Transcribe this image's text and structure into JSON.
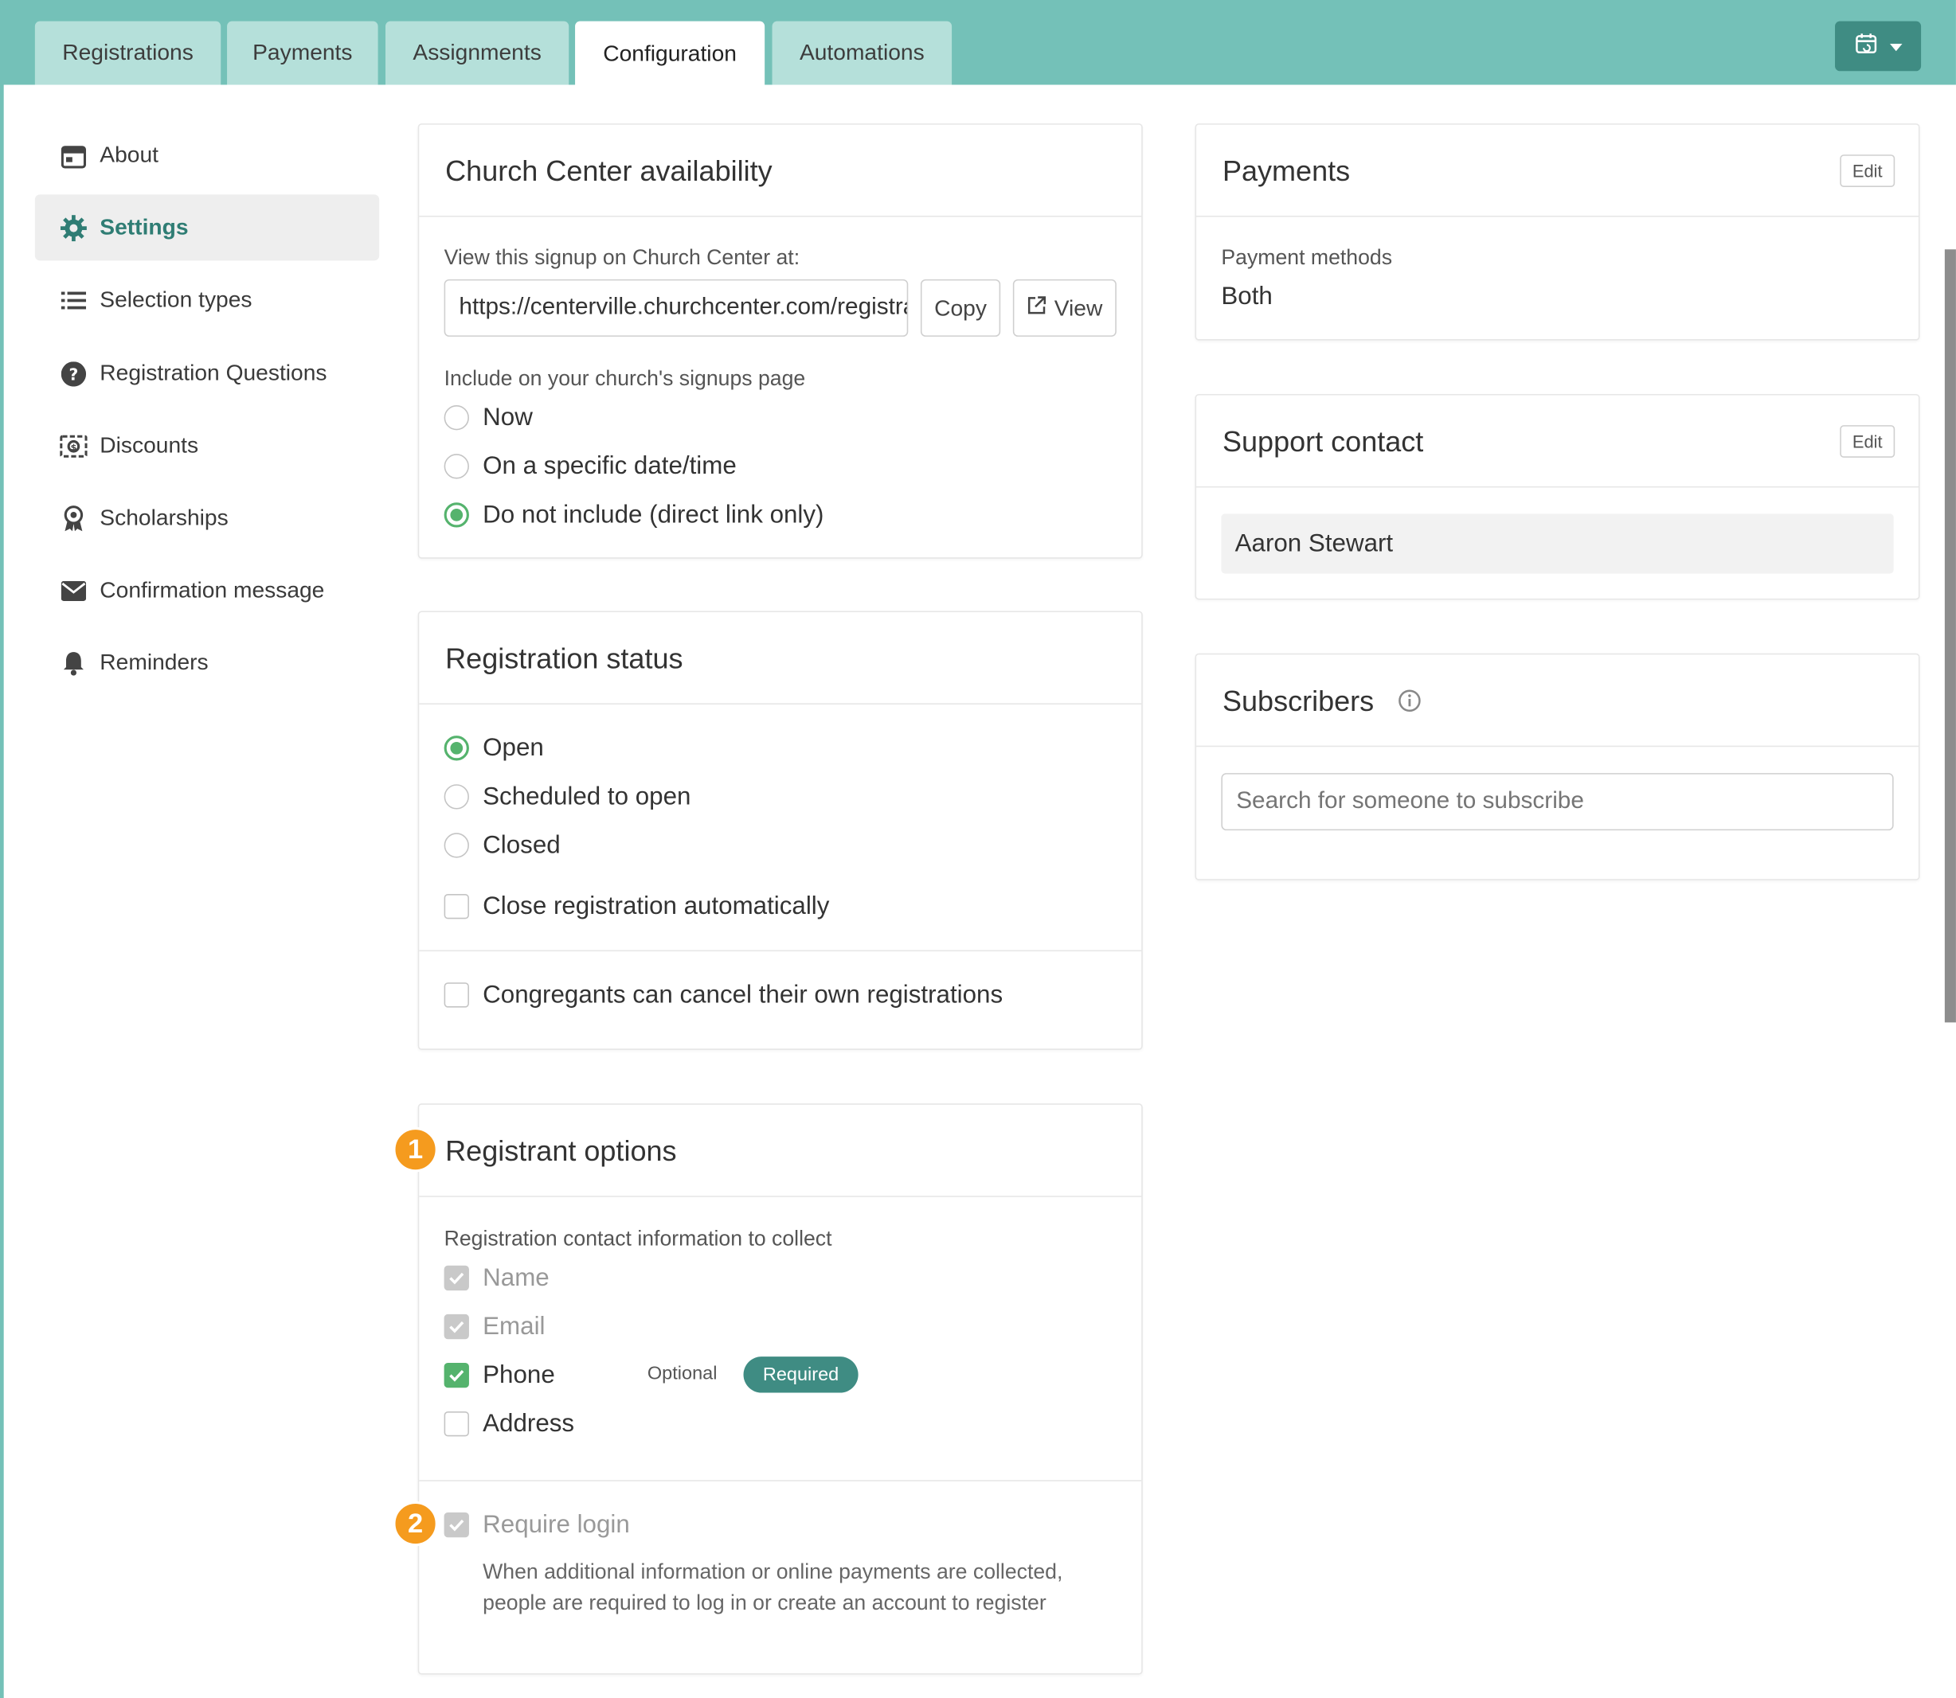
{
  "tabs": [
    {
      "label": "Registrations",
      "active": false
    },
    {
      "label": "Payments",
      "active": false
    },
    {
      "label": "Assignments",
      "active": false
    },
    {
      "label": "Configuration",
      "active": true
    },
    {
      "label": "Automations",
      "active": false
    }
  ],
  "header": {
    "calendar_icon": "calendar-sync-icon",
    "dropdown_icon": "caret-down-icon"
  },
  "colors": {
    "brand_bar": "#74c1b8",
    "brand_dark": "#3f8c83",
    "success": "#55b36d",
    "badge": "#f59b1e"
  },
  "sidebar": {
    "items": [
      {
        "label": "About",
        "icon": "calendar-icon",
        "active": false
      },
      {
        "label": "Settings",
        "icon": "gear-icon",
        "active": true
      },
      {
        "label": "Selection types",
        "icon": "list-icon",
        "active": false
      },
      {
        "label": "Registration Questions",
        "icon": "question-circle-icon",
        "active": false
      },
      {
        "label": "Discounts",
        "icon": "discount-icon",
        "active": false
      },
      {
        "label": "Scholarships",
        "icon": "award-ribbon-icon",
        "active": false
      },
      {
        "label": "Confirmation message",
        "icon": "envelope-icon",
        "active": false
      },
      {
        "label": "Reminders",
        "icon": "bell-icon",
        "active": false
      }
    ]
  },
  "availability": {
    "title": "Church Center availability",
    "view_label": "View this signup on Church Center at:",
    "url": "https://centerville.churchcenter.com/registrations",
    "copy_label": "Copy",
    "view_button": "View",
    "include_label": "Include on your church's signups page",
    "options": [
      {
        "label": "Now",
        "selected": false
      },
      {
        "label": "On a specific date/time",
        "selected": false
      },
      {
        "label": "Do not include (direct link only)",
        "selected": true
      }
    ]
  },
  "status": {
    "title": "Registration status",
    "options": [
      {
        "label": "Open",
        "selected": true
      },
      {
        "label": "Scheduled to open",
        "selected": false
      },
      {
        "label": "Closed",
        "selected": false
      }
    ],
    "auto_close": {
      "label": "Close registration automatically",
      "checked": false
    },
    "cancel_own": {
      "label": "Congregants can cancel their own registrations",
      "checked": false
    }
  },
  "registrant": {
    "title": "Registrant options",
    "badge1": "1",
    "badge2": "2",
    "collect_label": "Registration contact information to collect",
    "fields": [
      {
        "label": "Name",
        "checked": true,
        "disabled": true
      },
      {
        "label": "Email",
        "checked": true,
        "disabled": true
      },
      {
        "label": "Phone",
        "checked": true,
        "disabled": false
      },
      {
        "label": "Address",
        "checked": false,
        "disabled": false
      }
    ],
    "optional_label": "Optional",
    "required_label": "Required",
    "require_login": {
      "label": "Require login",
      "checked": true,
      "disabled": true
    },
    "help": "When additional information or online payments are collected, people are required to log in or create an account to register"
  },
  "payments": {
    "title": "Payments",
    "edit_label": "Edit",
    "methods_label": "Payment methods",
    "methods_value": "Both"
  },
  "support": {
    "title": "Support contact",
    "edit_label": "Edit",
    "contact": "Aaron Stewart"
  },
  "subscribers": {
    "title": "Subscribers",
    "info_icon": "info-circle-icon",
    "search_placeholder": "Search for someone to subscribe"
  }
}
